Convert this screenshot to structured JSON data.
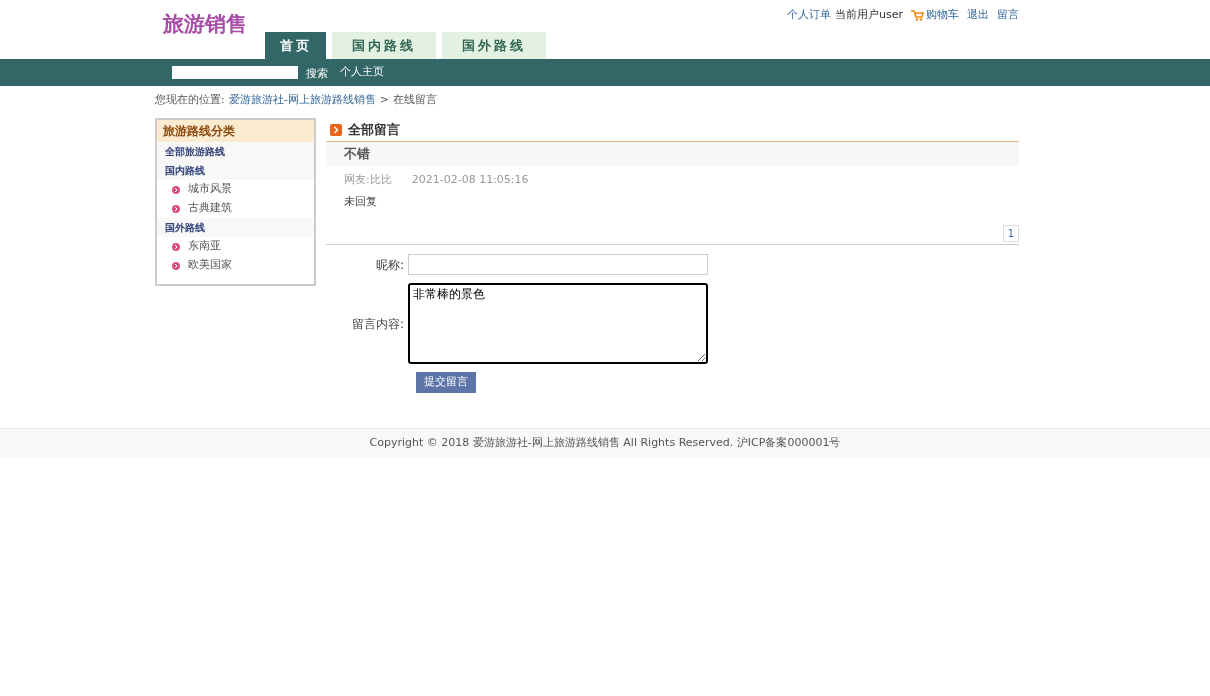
{
  "logo": "旅游销售",
  "top_links": [
    {
      "kind": "link",
      "label": "个人订单"
    },
    {
      "kind": "text",
      "label": "当前用户user"
    },
    {
      "kind": "cart",
      "label": "购物车"
    },
    {
      "kind": "link",
      "label": "退出"
    },
    {
      "kind": "link",
      "label": "留言"
    }
  ],
  "tabs": [
    {
      "label": "首页",
      "selected": true
    },
    {
      "label": "国内路线",
      "selected": false
    },
    {
      "label": "国外路线",
      "selected": false
    }
  ],
  "nav": {
    "search_button": "搜索",
    "links": [
      "个人主页"
    ]
  },
  "breadcrumb": {
    "prefix": "您现在的位置:",
    "items": [
      "爱游旅游社-网上旅游路线销售",
      "在线留言"
    ],
    "separator": ">"
  },
  "sidebar": {
    "title": "旅游路线分类",
    "groups": [
      {
        "label": "全部旅游路线"
      },
      {
        "label": "国内路线",
        "children": [
          {
            "label": "城市风景"
          },
          {
            "label": "古典建筑"
          }
        ]
      },
      {
        "label": "国外路线",
        "children": [
          {
            "label": "东南亚"
          },
          {
            "label": "欧美国家"
          }
        ]
      }
    ]
  },
  "messages": {
    "title": "全部留言",
    "items": [
      {
        "subject": "不错",
        "author": "网友:比比",
        "time": "2021-02-08 11:05:16",
        "reply": "未回复"
      }
    ],
    "pages": [
      "1"
    ]
  },
  "form": {
    "nickname_label": "昵称:",
    "content_label": "留言内容:",
    "content_value": "非常棒的景色",
    "submit": "提交留言"
  },
  "footer": "Copyright © 2018 爱游旅游社-网上旅游路线销售 All Rights Reserved. 沪ICP备案000001号"
}
